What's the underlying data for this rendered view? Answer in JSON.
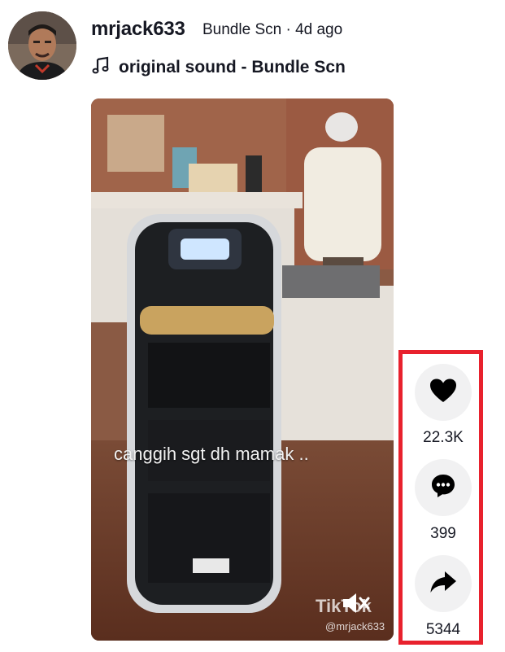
{
  "author": {
    "username": "mrjack633",
    "display_name": "Bundle Scn",
    "separator": "·",
    "posted": "4d ago"
  },
  "music": {
    "icon": "music-note-icon",
    "label": "original sound - Bundle Scn"
  },
  "video": {
    "caption": "canggih sgt dh mamak ..",
    "watermark_logo": "TikTok",
    "watermark_handle": "@mrjack633",
    "muted": true
  },
  "actions": {
    "like": {
      "icon": "heart-icon",
      "count": "22.3K"
    },
    "comment": {
      "icon": "comment-icon",
      "count": "399"
    },
    "share": {
      "icon": "share-icon",
      "count": "5344"
    }
  },
  "colors": {
    "highlight_border": "#e8212d",
    "action_bg": "#f1f1f2",
    "text": "#161823"
  }
}
